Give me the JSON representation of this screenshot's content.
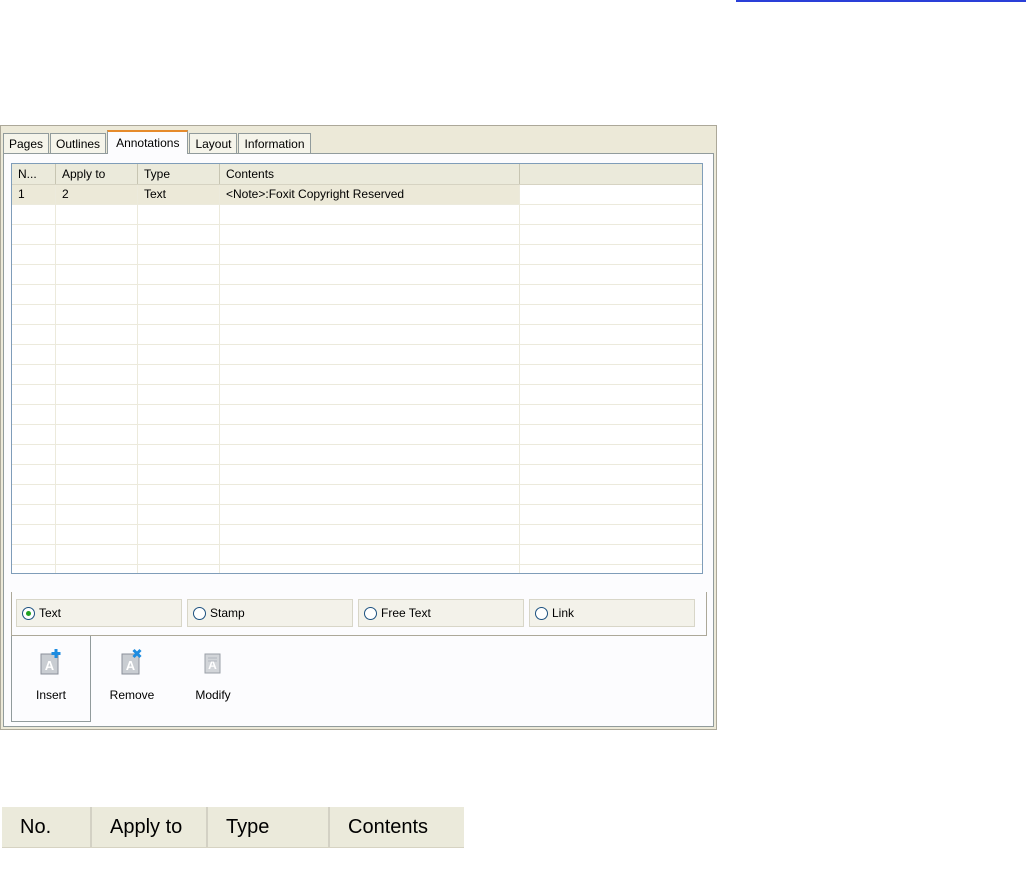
{
  "tabs": [
    {
      "label": "Pages"
    },
    {
      "label": "Outlines"
    },
    {
      "label": "Annotations"
    },
    {
      "label": "Layout"
    },
    {
      "label": "Information"
    }
  ],
  "active_tab": "Annotations",
  "annotations_list": {
    "columns": [
      "N...",
      "Apply to",
      "Type",
      "Contents",
      ""
    ],
    "rows": [
      {
        "no": "1",
        "apply_to": "2",
        "type": "Text",
        "contents": "<Note>:Foxit Copyright Reserved"
      }
    ]
  },
  "annotation_types": [
    {
      "label": "Text",
      "checked": true
    },
    {
      "label": "Stamp",
      "checked": false
    },
    {
      "label": "Free Text",
      "checked": false
    },
    {
      "label": "Link",
      "checked": false
    }
  ],
  "commands": [
    {
      "label": "Insert",
      "icon": "insert-annotation-icon"
    },
    {
      "label": "Remove",
      "icon": "remove-annotation-icon"
    },
    {
      "label": "Modify",
      "icon": "modify-annotation-icon"
    }
  ],
  "zoomed_header": {
    "columns": [
      "No.",
      "Apply to",
      "Type",
      "Contents"
    ]
  },
  "colors": {
    "active_tab_accent": "#e68b2c",
    "plus_badge": "#1e8ce0",
    "remove_badge": "#1e8ce0",
    "radio_checked": "#21a121"
  }
}
